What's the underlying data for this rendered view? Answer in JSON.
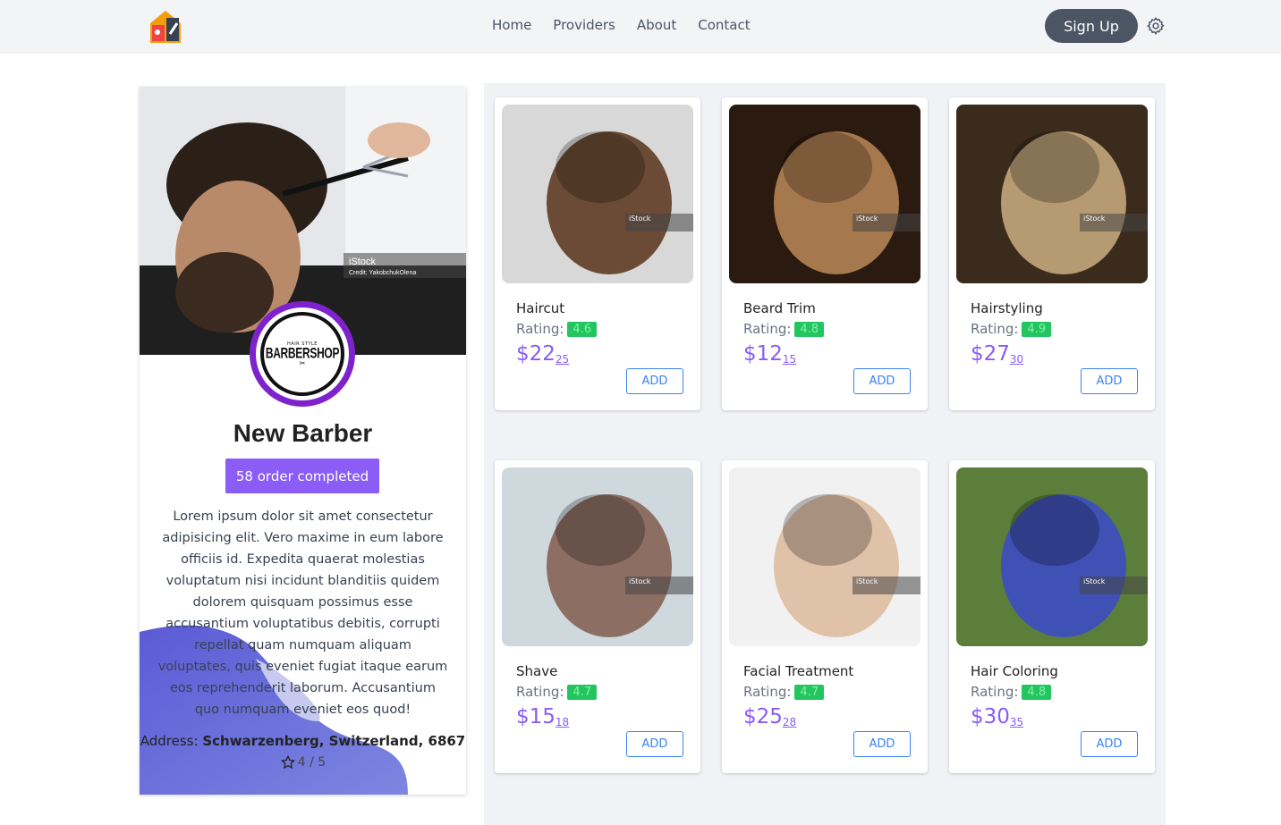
{
  "nav": {
    "links": [
      "Home",
      "Providers",
      "About",
      "Contact"
    ],
    "signup_label": "Sign Up",
    "logo_icon": "house-tools-logo",
    "settings_icon": "gear-icon"
  },
  "profile": {
    "logo_small": "HAIR STYLE",
    "logo_big": "BARBERSHOP",
    "name": "New Barber",
    "orders_label": "58 order completed",
    "description": "Lorem ipsum dolor sit amet consectetur adipisicing elit. Vero maxime in eum labore officiis id. Expedita quaerat molestias voluptatum nisi incidunt blanditiis quidem dolorem quisquam possimus esse accusantium voluptatibus debitis, corrupti repellat quam numquam aliquam voluptates, quis eveniet fugiat itaque earum eos reprehenderit laborum. Accusantium quo numquam eveniet eos quod!",
    "address_label": "Address:",
    "address_value": "Schwarzenberg, Switzerland, 6867",
    "rating_text": "4 / 5",
    "cover_watermark": "iStock",
    "cover_credit": "Credit: YakobchukOlena"
  },
  "services": [
    {
      "title": "Haircut",
      "rating_label": "Rating:",
      "rating": "4.6",
      "price_main": "$22",
      "price_cents": "25",
      "add_label": "ADD",
      "watermark": "iStock",
      "colors": [
        "#d8d8d8",
        "#6b4b35"
      ]
    },
    {
      "title": "Beard Trim",
      "rating_label": "Rating:",
      "rating": "4.8",
      "price_main": "$12",
      "price_cents": "15",
      "add_label": "ADD",
      "watermark": "iStock",
      "colors": [
        "#2a1a10",
        "#a6784e"
      ]
    },
    {
      "title": "Hairstyling",
      "rating_label": "Rating:",
      "rating": "4.9",
      "price_main": "$27",
      "price_cents": "30",
      "add_label": "ADD",
      "watermark": "iStock",
      "colors": [
        "#3a2b1c",
        "#b59a72"
      ]
    },
    {
      "title": "Shave",
      "rating_label": "Rating:",
      "rating": "4.7",
      "price_main": "$15",
      "price_cents": "18",
      "add_label": "ADD",
      "watermark": "iStock",
      "colors": [
        "#cfd8dc",
        "#8d6e63"
      ]
    },
    {
      "title": "Facial Treatment",
      "rating_label": "Rating:",
      "rating": "4.7",
      "price_main": "$25",
      "price_cents": "28",
      "add_label": "ADD",
      "watermark": "iStock",
      "colors": [
        "#f1f1f1",
        "#e0c2a8"
      ]
    },
    {
      "title": "Hair Coloring",
      "rating_label": "Rating:",
      "rating": "4.8",
      "price_main": "$30",
      "price_cents": "35",
      "add_label": "ADD",
      "watermark": "iStock",
      "colors": [
        "#5b7f3a",
        "#3f51b5"
      ]
    }
  ]
}
